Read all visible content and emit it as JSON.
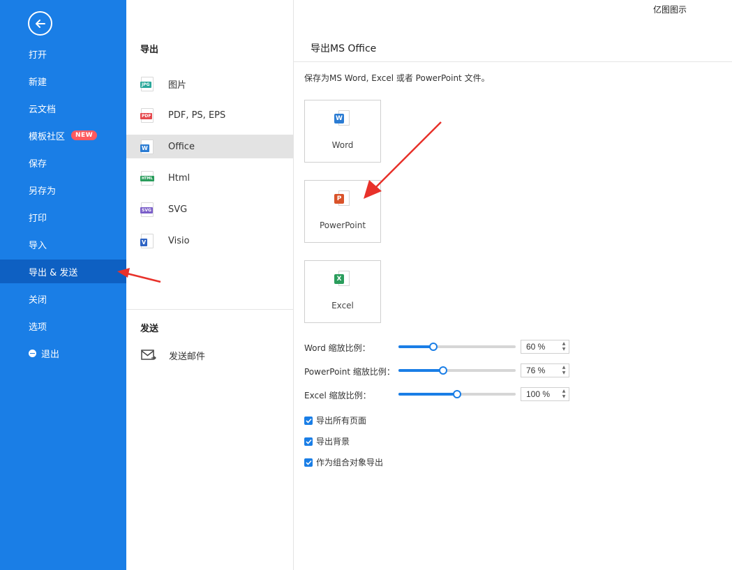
{
  "app": {
    "brand": "亿图图示"
  },
  "sidebar": {
    "items": [
      {
        "label": "打开"
      },
      {
        "label": "新建"
      },
      {
        "label": "云文档"
      },
      {
        "label": "模板社区",
        "badge": "NEW"
      },
      {
        "label": "保存"
      },
      {
        "label": "另存为"
      },
      {
        "label": "打印"
      },
      {
        "label": "导入"
      },
      {
        "label": "导出 & 发送",
        "active": true
      },
      {
        "label": "关闭"
      },
      {
        "label": "选项"
      },
      {
        "label": "退出"
      }
    ]
  },
  "export": {
    "title": "导出",
    "items": [
      {
        "label": "图片",
        "icon": "jpg-file-icon",
        "tag": "JPG",
        "color": "#2aa89a"
      },
      {
        "label": "PDF, PS, EPS",
        "icon": "pdf-file-icon",
        "tag": "PDF",
        "color": "#e5484d"
      },
      {
        "label": "Office",
        "icon": "word-file-icon",
        "tag": "W",
        "color": "#2b7cd3",
        "active": true
      },
      {
        "label": "Html",
        "icon": "html-file-icon",
        "tag": "HTML",
        "color": "#2a9d5c"
      },
      {
        "label": "SVG",
        "icon": "svg-file-icon",
        "tag": "SVG",
        "color": "#7b5fc9"
      },
      {
        "label": "Visio",
        "icon": "visio-file-icon",
        "tag": "V",
        "color": "#2f64c4"
      }
    ]
  },
  "send": {
    "title": "发送",
    "email_label": "发送邮件"
  },
  "panel": {
    "title": "导出MS Office",
    "description": "保存为MS Word, Excel 或者 PowerPoint 文件。",
    "formats": [
      {
        "label": "Word",
        "letter": "W",
        "color": "#2b7cd3"
      },
      {
        "label": "PowerPoint",
        "letter": "P",
        "color": "#d9532a"
      },
      {
        "label": "Excel",
        "letter": "X",
        "color": "#2a9d5c"
      }
    ],
    "scales": [
      {
        "label": "Word 缩放比例：",
        "value": "60 %",
        "level": 0.3
      },
      {
        "label": "PowerPoint 缩放比例：",
        "value": "76 %",
        "level": 0.38
      },
      {
        "label": "Excel 缩放比例：",
        "value": "100 %",
        "level": 0.5
      }
    ],
    "options": [
      {
        "label": "导出所有页面",
        "checked": true
      },
      {
        "label": "导出背景",
        "checked": true
      },
      {
        "label": "作为组合对象导出",
        "checked": true
      }
    ]
  }
}
